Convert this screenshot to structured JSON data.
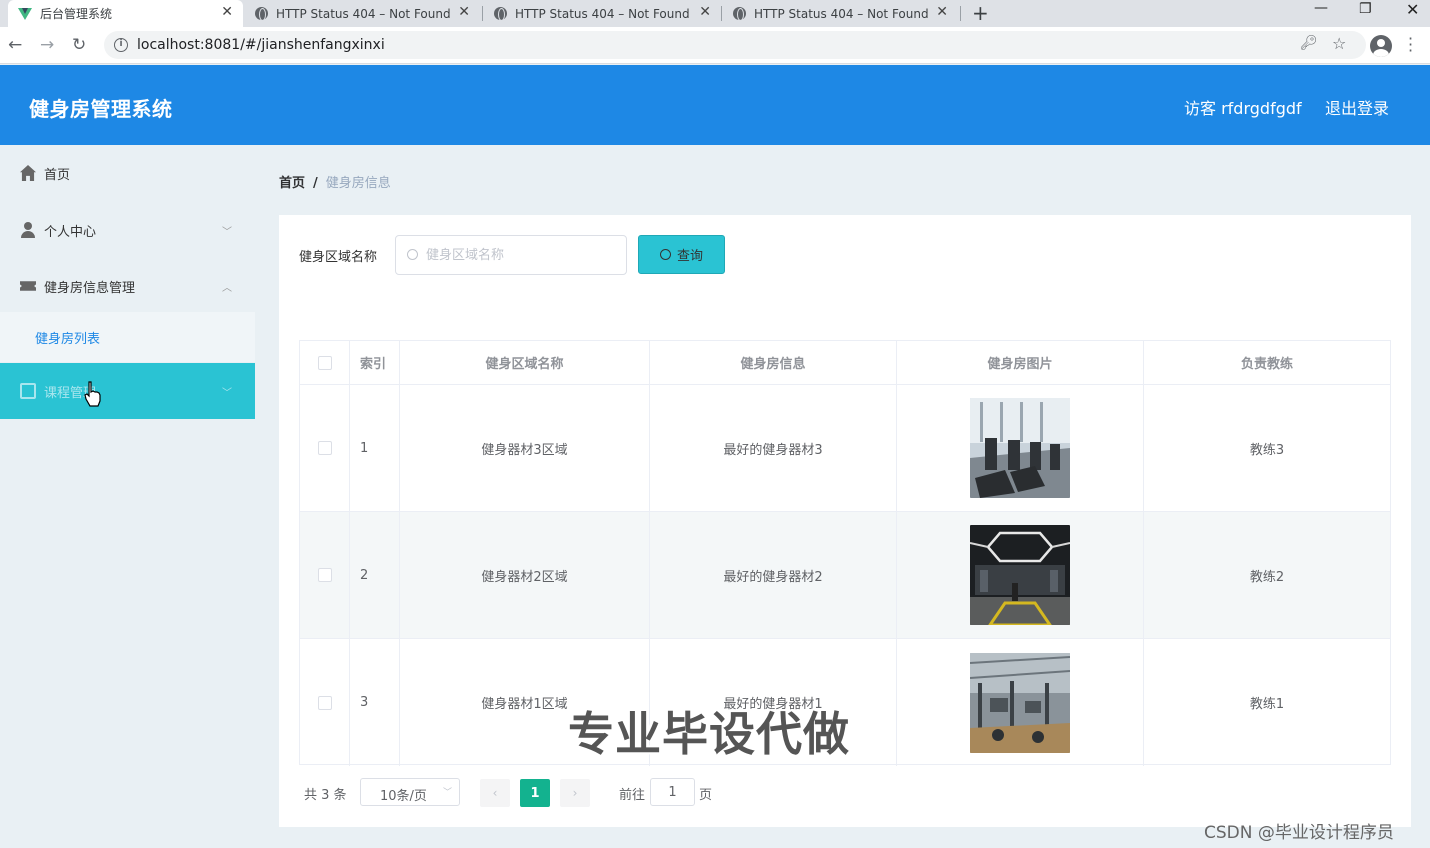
{
  "browser": {
    "tabs": [
      {
        "title": "后台管理系统",
        "active": true
      },
      {
        "title": "HTTP Status 404 – Not Found",
        "active": false
      },
      {
        "title": "HTTP Status 404 – Not Found",
        "active": false
      },
      {
        "title": "HTTP Status 404 – Not Found",
        "active": false
      }
    ],
    "url": "localhost:8081/#/jianshenfangxinxi"
  },
  "header": {
    "title": "健身房管理系统",
    "user_label": "访客 rfdrgdfgdf",
    "logout_label": "退出登录",
    "color": "#1e88e5"
  },
  "sidebar": {
    "items": [
      {
        "label": "首页",
        "icon": "home-icon"
      },
      {
        "label": "个人中心",
        "icon": "user-icon",
        "expandable": true,
        "expanded": false
      },
      {
        "label": "健身房信息管理",
        "icon": "ticket-icon",
        "expandable": true,
        "expanded": true
      },
      {
        "label": "健身房列表",
        "submenu": true
      },
      {
        "label": "课程管理",
        "icon": "course-icon",
        "expandable": true,
        "highlighted": true
      }
    ],
    "highlight_color": "#2ac3d3"
  },
  "breadcrumb": {
    "home": "首页",
    "separator": "/",
    "current": "健身房信息"
  },
  "search": {
    "label": "健身区域名称",
    "placeholder": "健身区域名称",
    "value": "",
    "button_label": "查询"
  },
  "table": {
    "columns": [
      "索引",
      "健身区域名称",
      "健身房信息",
      "健身房图片",
      "负责教练"
    ],
    "rows": [
      {
        "index": "1",
        "area": "健身器材3区域",
        "info": "最好的健身器材3",
        "image": "treadmill-row-photo",
        "coach": "教练3"
      },
      {
        "index": "2",
        "area": "健身器材2区域",
        "info": "最好的健身器材2",
        "image": "dark-gym-hall-photo",
        "coach": "教练2"
      },
      {
        "index": "3",
        "area": "健身器材1区域",
        "info": "最好的健身器材1",
        "image": "weight-room-photo",
        "coach": "教练1"
      }
    ]
  },
  "pagination": {
    "total": "共 3 条",
    "page_size": "10条/页",
    "prev": "‹",
    "next": "›",
    "current_page": "1",
    "goto_label": "前往",
    "goto_value": "1",
    "page_suffix": "页",
    "active_color": "#13b28f"
  },
  "watermarks": {
    "center": "专业毕设代做",
    "corner": "CSDN @毕业设计程序员"
  }
}
